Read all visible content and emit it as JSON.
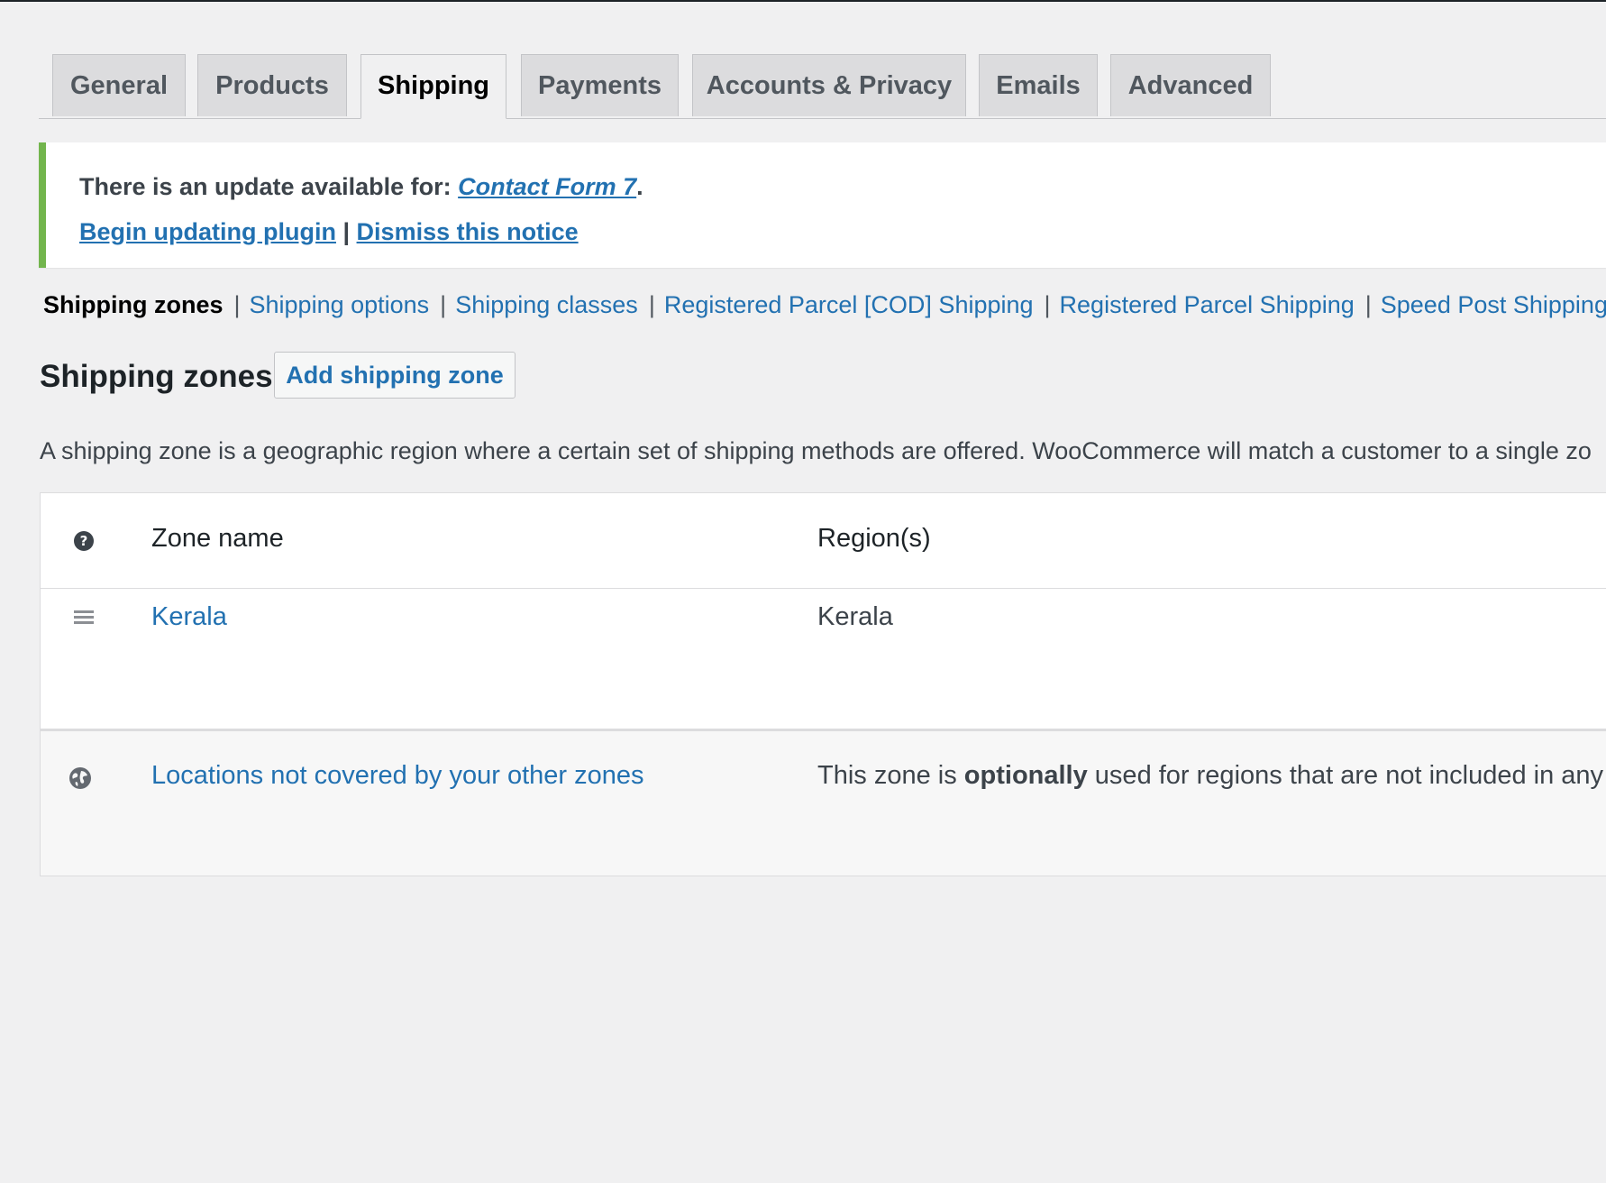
{
  "tabs": [
    {
      "label": "General",
      "active": false
    },
    {
      "label": "Products",
      "active": false
    },
    {
      "label": "Shipping",
      "active": true
    },
    {
      "label": "Payments",
      "active": false
    },
    {
      "label": "Accounts & Privacy",
      "active": false
    },
    {
      "label": "Emails",
      "active": false
    },
    {
      "label": "Advanced",
      "active": false
    }
  ],
  "notice": {
    "text_prefix": "There is an update available for: ",
    "plugin_name": "Contact Form 7",
    "period": ".",
    "begin_update": "Begin updating plugin",
    "separator": "|",
    "dismiss": "Dismiss this notice",
    "border_color": "#72b54d"
  },
  "subnav": {
    "current": "Shipping zones",
    "links": [
      "Shipping options",
      "Shipping classes",
      "Registered Parcel [COD] Shipping",
      "Registered Parcel Shipping",
      "Speed Post Shipping"
    ],
    "separator": "|"
  },
  "page": {
    "heading": "Shipping zones",
    "add_button": "Add shipping zone",
    "description": "A shipping zone is a geographic region where a certain set of shipping methods are offered. WooCommerce will match a customer to a single zo"
  },
  "table": {
    "headers": {
      "help_icon": "question-circle-icon",
      "zone_name": "Zone name",
      "regions": "Region(s)"
    },
    "rows": [
      {
        "icon": "drag-handle-icon",
        "zone_name": "Kerala",
        "region": "Kerala"
      }
    ],
    "fallback_row": {
      "icon": "globe-icon",
      "zone_name": "Locations not covered by your other zones",
      "region_prefix": "This zone is ",
      "region_bold": "optionally",
      "region_suffix": " used for regions that are not included in any"
    }
  },
  "colors": {
    "link": "#2271b1",
    "background": "#f0f0f1"
  }
}
